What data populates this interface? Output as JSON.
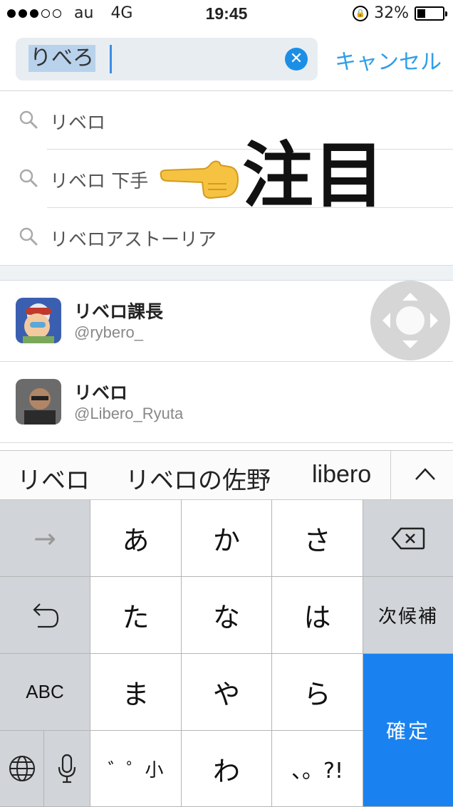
{
  "status": {
    "carrier": "au",
    "network": "4G",
    "time": "19:45",
    "battery": "32%",
    "battery_level": 0.32
  },
  "search": {
    "query": "りべろ",
    "cancel_label": "キャンセル"
  },
  "suggestions": [
    "リベロ",
    "リベロ 下手",
    "リベロアストーリア"
  ],
  "annotation": "注目",
  "users": [
    {
      "name": "リベロ課長",
      "handle": "@rybero_"
    },
    {
      "name": "リベロ",
      "handle": "@Libero_Ryuta"
    }
  ],
  "candidates": [
    "リベロ",
    "リベロの佐野",
    "libero"
  ],
  "keyboard": {
    "row1": [
      "→",
      "あ",
      "か",
      "さ"
    ],
    "row2": [
      "た",
      "な",
      "は"
    ],
    "next_candidate": "次候補",
    "row3": [
      "ABC",
      "ま",
      "や",
      "ら"
    ],
    "confirm": "確定",
    "row4": [
      "゛゜小",
      "わ",
      "、。?!"
    ]
  }
}
